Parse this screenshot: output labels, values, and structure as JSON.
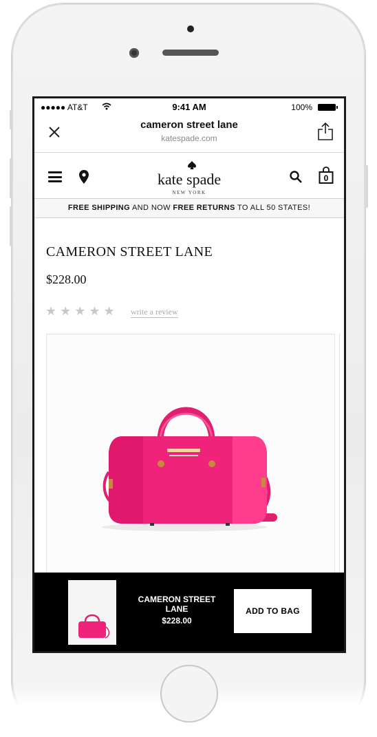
{
  "status_bar": {
    "carrier": "●●●●● AT&T",
    "time": "9:41 AM",
    "battery": "100%"
  },
  "browser": {
    "title": "cameron street lane",
    "domain": "katespade.com"
  },
  "header": {
    "logo": "kate spade",
    "logo_sub": "NEW YORK"
  },
  "promo": {
    "part1": "FREE SHIPPING",
    "part2": " AND NOW ",
    "part3": "FREE RETURNS",
    "part4": " TO ALL 50 STATES!"
  },
  "product": {
    "name": "CAMERON STREET LANE",
    "price": "$228.00",
    "rating_stars": 5,
    "review_link": "write a review",
    "color": "#f0237a"
  },
  "sticky_bar": {
    "title": "CAMERON STREET LANE",
    "price": "$228.00",
    "add_button": "ADD TO BAG"
  },
  "bag_count": "0"
}
